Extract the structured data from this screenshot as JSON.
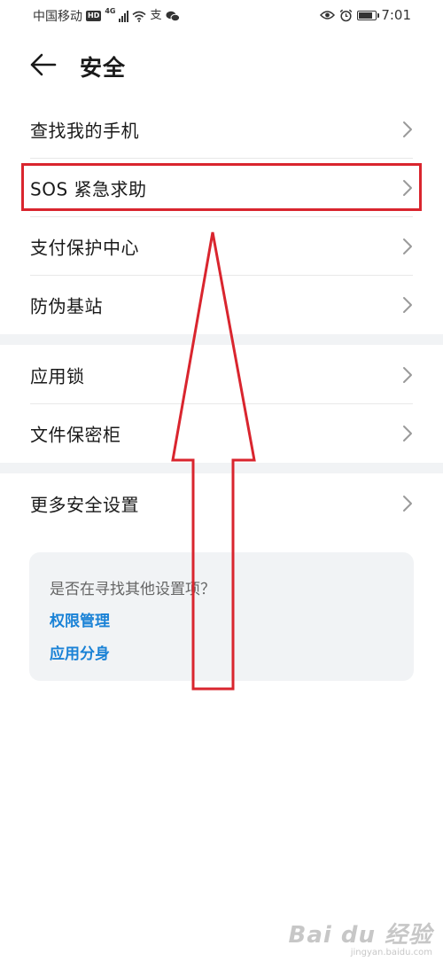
{
  "status_bar": {
    "carrier": "中国移动",
    "hd_badge": "HD",
    "network_type": "4G",
    "time": "7:01",
    "icons": [
      "hd-badge",
      "cellular-signal-icon",
      "wifi-icon",
      "alipay-icon",
      "wechat-icon",
      "eye-comfort-icon",
      "alarm-icon",
      "battery-icon"
    ]
  },
  "header": {
    "title": "安全",
    "back_icon": "arrow-left-icon"
  },
  "groups": [
    {
      "items": [
        {
          "label": "查找我的手机"
        },
        {
          "label": "SOS 紧急求助"
        },
        {
          "label": "支付保护中心"
        },
        {
          "label": "防伪基站"
        }
      ]
    },
    {
      "items": [
        {
          "label": "应用锁"
        },
        {
          "label": "文件保密柜"
        }
      ]
    },
    {
      "items": [
        {
          "label": "更多安全设置"
        }
      ]
    }
  ],
  "suggestion_card": {
    "question": "是否在寻找其他设置项？",
    "links": [
      {
        "label": "权限管理"
      },
      {
        "label": "应用分身"
      }
    ]
  },
  "annotation": {
    "color": "#d9252e",
    "highlighted_item": "SOS 紧急求助"
  },
  "watermark": {
    "main": "Bai du 经验",
    "sub": "jingyan.baidu.com"
  },
  "colors": {
    "link": "#1a82d6",
    "separator_band": "#f1f3f5",
    "card_bg": "#f1f3f5"
  }
}
